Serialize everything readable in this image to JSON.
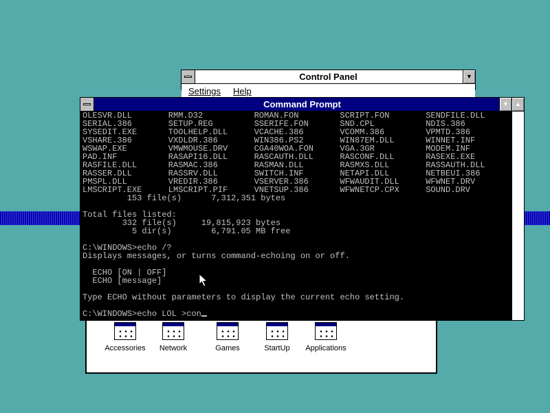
{
  "control_panel": {
    "title": "Control Panel",
    "menu": [
      {
        "label": "Settings"
      },
      {
        "label": "Help"
      }
    ]
  },
  "command_prompt": {
    "title": "Command Prompt",
    "file_rows": [
      [
        "OLESVR.DLL",
        "RMM.D32",
        "ROMAN.FON",
        "SCRIPT.FON",
        "SENDFILE.DLL"
      ],
      [
        "SERIAL.386",
        "SETUP.REG",
        "SSERIFE.FON",
        "SND.CPL",
        "NDIS.386"
      ],
      [
        "SYSEDIT.EXE",
        "TOOLHELP.DLL",
        "VCACHE.386",
        "VCOMM.386",
        "VPMTD.386"
      ],
      [
        "VSHARE.386",
        "VXDLDR.386",
        "WIN386.PS2",
        "WIN87EM.DLL",
        "WINNET.INF"
      ],
      [
        "WSWAP.EXE",
        "VMWMOUSE.DRV",
        "CGA40WOA.FON",
        "VGA.3GR",
        "MODEM.INF"
      ],
      [
        "PAD.INF",
        "RASAPI16.DLL",
        "RASCAUTH.DLL",
        "RASCONF.DLL",
        "RASEXE.EXE"
      ],
      [
        "RASFILE.DLL",
        "RASMAC.386",
        "RASMAN.DLL",
        "RASMXS.DLL",
        "RASSAUTH.DLL"
      ],
      [
        "RASSER.DLL",
        "RASSRV.DLL",
        "SWITCH.INF",
        "NETAPI.DLL",
        "NETBEUI.386"
      ],
      [
        "PMSPL.DLL",
        "VREDIR.386",
        "VSERVER.386",
        "WFWAUDIT.DLL",
        "WFWNET.DRV"
      ],
      [
        "LMSCRIPT.EXE",
        "LMSCRIPT.PIF",
        "VNETSUP.386",
        "WFWNETCP.CPX",
        "SOUND.DRV"
      ]
    ],
    "lines": [
      "         153 file(s)      7,312,351 bytes",
      "",
      "Total files listed:",
      "        332 file(s)     19,815,923 bytes",
      "          5 dir(s)        6,791.05 MB free",
      "",
      "C:\\WINDOWS>echo /?",
      "Displays messages, or turns command-echoing on or off.",
      "",
      "  ECHO [ON | OFF]",
      "  ECHO [message]",
      "",
      "Type ECHO without parameters to display the current echo setting.",
      "",
      "C:\\WINDOWS>echo LOL >con"
    ]
  },
  "program_group": {
    "icons": [
      {
        "label": "Accessories"
      },
      {
        "label": "Network"
      },
      {
        "label": "Games"
      },
      {
        "label": "StartUp"
      },
      {
        "label": "Applications"
      }
    ]
  },
  "colors": {
    "desktop": "#55aaaa",
    "title_active": "#000080",
    "console_text": "#c0c0c0"
  }
}
